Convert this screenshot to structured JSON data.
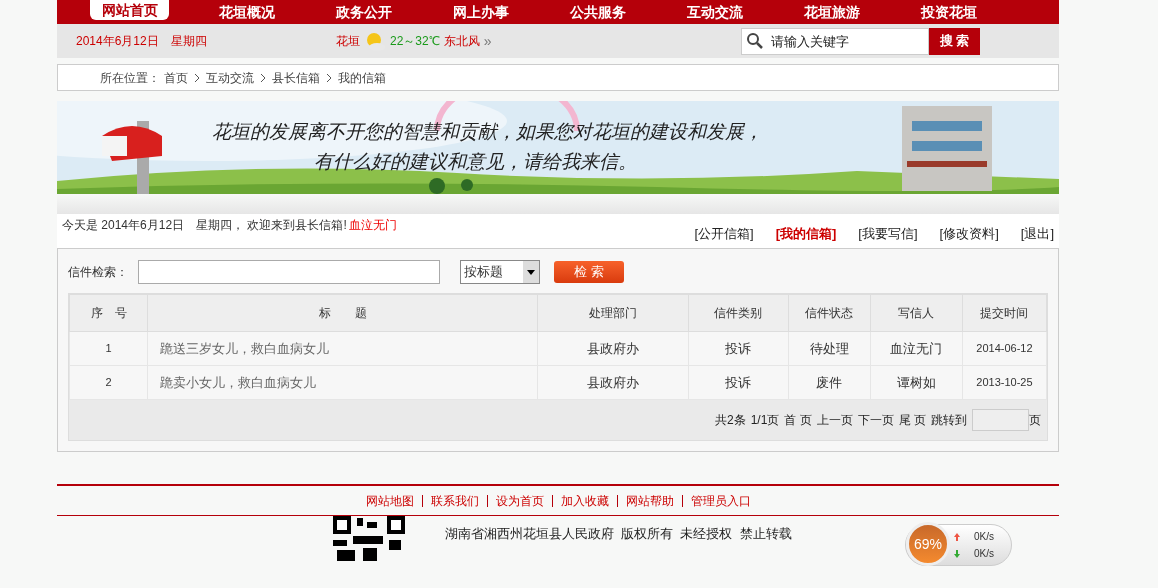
{
  "nav": [
    {
      "label": "网站首页",
      "selected": true
    },
    {
      "label": "花垣概况",
      "selected": false
    },
    {
      "label": "政务公开",
      "selected": false
    },
    {
      "label": "网上办事",
      "selected": false
    },
    {
      "label": "公共服务",
      "selected": false
    },
    {
      "label": "互动交流",
      "selected": false
    },
    {
      "label": "花垣旅游",
      "selected": false
    },
    {
      "label": "投资花垣",
      "selected": false
    }
  ],
  "info_bar": {
    "date": "2014年6月12日",
    "weekday": "星期四",
    "city": "花垣",
    "temperature": "22～32℃",
    "wind": "东北风",
    "more": "»",
    "search_placeholder": "请输入关键字",
    "search_button": "搜 索"
  },
  "breadcrumb": {
    "label": "所在位置：",
    "items": [
      "首页",
      "互动交流",
      "县长信箱",
      "我的信箱"
    ]
  },
  "banner": {
    "line_1": "花垣的发展离不开您的智慧和贡献，如果您对花垣的建设和发展，",
    "line_2": "有什么好的建议和意见，请给我来信。"
  },
  "welcome": {
    "prefix": "今天是",
    "date": "2014年6月12日",
    "weekday": "星期四，",
    "text": "欢迎来到县长信箱!",
    "user": "血泣无门"
  },
  "mailbox_tabs": [
    {
      "label": "[公开信箱]",
      "selected": false
    },
    {
      "label": "[我的信箱]",
      "selected": true
    },
    {
      "label": "[我要写信]",
      "selected": false
    },
    {
      "label": "[修改资料]",
      "selected": false
    },
    {
      "label": "[退出]",
      "selected": false
    }
  ],
  "search": {
    "label": "信件检索：",
    "mode": "按标题",
    "button": "检  索"
  },
  "table": {
    "columns": [
      "序　号",
      "标　　题",
      "处理部门",
      "信件类别",
      "信件状态",
      "写信人",
      "提交时间"
    ],
    "rows": [
      [
        "1",
        "跪送三岁女儿，救白血病女儿",
        "县政府办",
        "投诉",
        "待处理",
        "血泣无门",
        "2014-06-12"
      ],
      [
        "2",
        "跪卖小女儿，救白血病女儿",
        "县政府办",
        "投诉",
        "废件",
        "谭树如",
        "2013-10-25"
      ]
    ]
  },
  "pagination": {
    "summary": "共2条",
    "pages": "1/1页",
    "first": "首 页",
    "prev": "上一页",
    "next": "下一页",
    "last": "尾 页",
    "jump_label": "跳转到",
    "page_unit": "页"
  },
  "footer_links": [
    "网站地图",
    "联系我们",
    "设为首页",
    "加入收藏",
    "网站帮助",
    "管理员入口"
  ],
  "copyright": "湖南省湘西州花垣县人民政府  版权所有  未经授权  禁止转载",
  "speed_widget": {
    "percent": "69%",
    "upload": "0K/s",
    "download": "0K/s"
  }
}
